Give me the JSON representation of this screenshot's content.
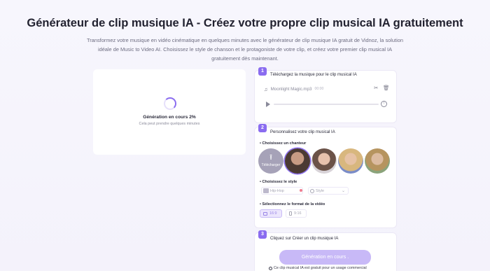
{
  "title": "Générateur de clip musique IA - Créez votre propre clip musical IA gratuitement",
  "subtitle": "Transformez votre musique en vidéo cinématique en quelques minutes avec le générateur de clip musique IA gratuit de Vidnoz, la solution idéale de Music to Video AI. Choisissez le style de chanson et le protagoniste de votre clip, et créez votre premier clip musical IA gratuitement dès maintenant.",
  "preview": {
    "status": "Génération en cours 2%",
    "hint": "Cela peut prendre quelques minutes",
    "progress_percent": 2
  },
  "step1": {
    "number": "1",
    "title": "Téléchargez la musique pour le clip musical IA",
    "file_name": "Moonlight Magic.mp3",
    "file_duration": "00:00"
  },
  "step2": {
    "number": "2",
    "title": "Personnalisez votre clip musical IA",
    "singer_label": "Choisissez un chanteur",
    "upload_label": "Télécharger",
    "style_label": "Choisissez le style",
    "style_value": "Hip-Hop",
    "style_placeholder": "Style",
    "format_label": "Sélectionnez le format de la vidéo",
    "formats": [
      "16:9",
      "9:16"
    ]
  },
  "step3": {
    "number": "3",
    "title": "Cliquez sur Créer un clip musique IA",
    "button_label": "Génération en cours .",
    "footnote": "Ce clip musical IA est gratuit pour un usage commercial"
  },
  "colors": {
    "accent": "#8a6cf0",
    "button_disabled": "#c8b9f7"
  }
}
